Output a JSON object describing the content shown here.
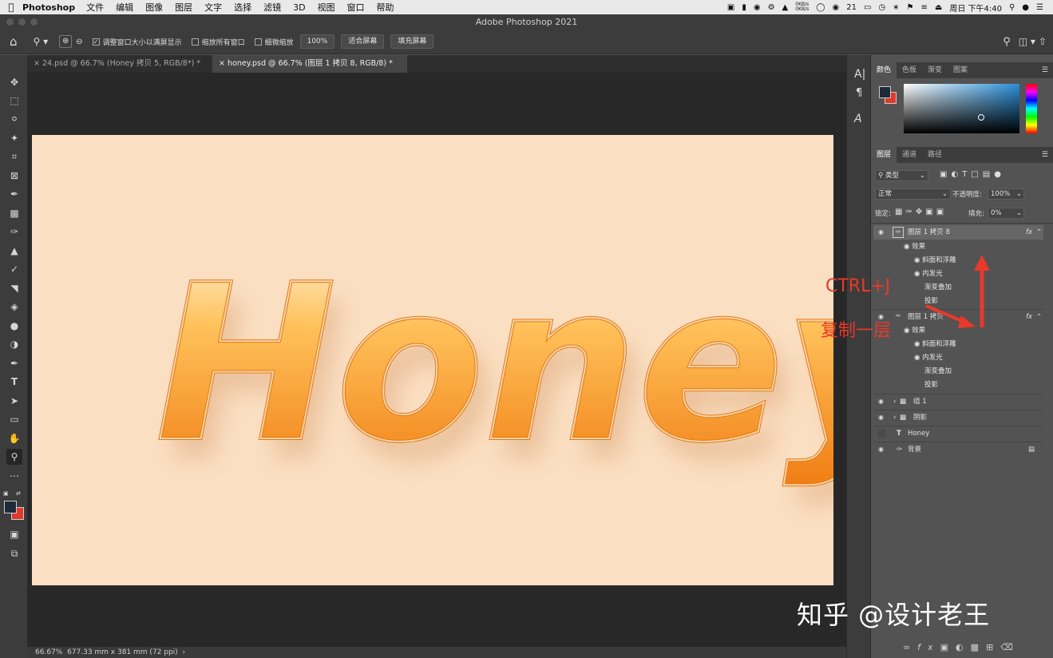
{
  "menubar": {
    "app_name": "Photoshop",
    "items": [
      "文件",
      "编辑",
      "图像",
      "图层",
      "文字",
      "选择",
      "滤镜",
      "3D",
      "视图",
      "窗口",
      "帮助"
    ],
    "netspeed_up": "0KB/s",
    "netspeed_down": "0KB/s",
    "wechat_count": "21",
    "clock": "周日 下午4:40"
  },
  "window": {
    "title": "Adobe Photoshop 2021"
  },
  "options": {
    "checkbox1_label": "调整窗口大小以满屏显示",
    "checkbox2_label": "缩放所有窗口",
    "checkbox3_label": "细微缩放",
    "zoom_value": "100%",
    "fit_screen": "适合屏幕",
    "fill_screen": "填充屏幕"
  },
  "tabs": [
    {
      "label": "24.psd @ 66.7% (Honey 拷贝 5, RGB/8*) *"
    },
    {
      "label": "honey.psd @ 66.7% (图层 1 拷贝 8, RGB/8) *"
    }
  ],
  "canvas": {
    "text": "Honey",
    "background_color": "#fbdfc2",
    "honey_color": "#f39a24"
  },
  "status": {
    "zoom": "66.67%",
    "size": "677.33 mm x 381 mm (72 ppi)"
  },
  "color_panel": {
    "tabs": [
      "颜色",
      "色板",
      "渐变",
      "图案"
    ],
    "foreground": "#1e2a38",
    "background": "#e0392b"
  },
  "layers_panel": {
    "tabs": [
      "图层",
      "通道",
      "路径"
    ],
    "filter_kind": "类型",
    "blend_mode": "正常",
    "opacity_label": "不透明度:",
    "opacity_value": "100%",
    "lock_label": "锁定:",
    "fill_label": "填充:",
    "fill_value": "0%",
    "layers": [
      {
        "name": "图层 1 拷贝 8",
        "fx": "fx",
        "effects_label": "效果",
        "effects": [
          "斜面和浮雕",
          "内发光",
          "渐变叠加",
          "投影"
        ]
      },
      {
        "name": "图层 1 拷贝",
        "fx": "fx",
        "effects_label": "效果",
        "effects": [
          "斜面和浮雕",
          "内发光",
          "渐变叠加",
          "投影"
        ]
      },
      {
        "name": "组 1"
      },
      {
        "name": "阴影"
      },
      {
        "name": "Honey"
      },
      {
        "name": "背景"
      }
    ]
  },
  "annotations": {
    "shortcut": "CTRL+J",
    "caption": "复制一层"
  },
  "watermark": "知乎 @设计老王"
}
